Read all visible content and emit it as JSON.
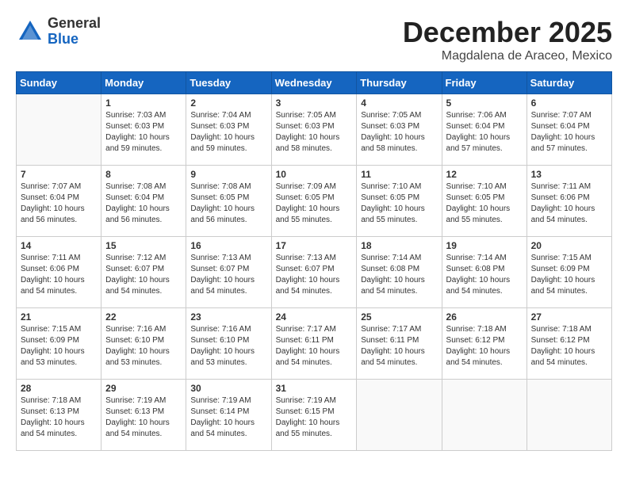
{
  "header": {
    "logo_general": "General",
    "logo_blue": "Blue",
    "month_title": "December 2025",
    "location": "Magdalena de Araceo, Mexico"
  },
  "days_of_week": [
    "Sunday",
    "Monday",
    "Tuesday",
    "Wednesday",
    "Thursday",
    "Friday",
    "Saturday"
  ],
  "weeks": [
    [
      {
        "day": "",
        "info": ""
      },
      {
        "day": "1",
        "info": "Sunrise: 7:03 AM\nSunset: 6:03 PM\nDaylight: 10 hours\nand 59 minutes."
      },
      {
        "day": "2",
        "info": "Sunrise: 7:04 AM\nSunset: 6:03 PM\nDaylight: 10 hours\nand 59 minutes."
      },
      {
        "day": "3",
        "info": "Sunrise: 7:05 AM\nSunset: 6:03 PM\nDaylight: 10 hours\nand 58 minutes."
      },
      {
        "day": "4",
        "info": "Sunrise: 7:05 AM\nSunset: 6:03 PM\nDaylight: 10 hours\nand 58 minutes."
      },
      {
        "day": "5",
        "info": "Sunrise: 7:06 AM\nSunset: 6:04 PM\nDaylight: 10 hours\nand 57 minutes."
      },
      {
        "day": "6",
        "info": "Sunrise: 7:07 AM\nSunset: 6:04 PM\nDaylight: 10 hours\nand 57 minutes."
      }
    ],
    [
      {
        "day": "7",
        "info": "Sunrise: 7:07 AM\nSunset: 6:04 PM\nDaylight: 10 hours\nand 56 minutes."
      },
      {
        "day": "8",
        "info": "Sunrise: 7:08 AM\nSunset: 6:04 PM\nDaylight: 10 hours\nand 56 minutes."
      },
      {
        "day": "9",
        "info": "Sunrise: 7:08 AM\nSunset: 6:05 PM\nDaylight: 10 hours\nand 56 minutes."
      },
      {
        "day": "10",
        "info": "Sunrise: 7:09 AM\nSunset: 6:05 PM\nDaylight: 10 hours\nand 55 minutes."
      },
      {
        "day": "11",
        "info": "Sunrise: 7:10 AM\nSunset: 6:05 PM\nDaylight: 10 hours\nand 55 minutes."
      },
      {
        "day": "12",
        "info": "Sunrise: 7:10 AM\nSunset: 6:05 PM\nDaylight: 10 hours\nand 55 minutes."
      },
      {
        "day": "13",
        "info": "Sunrise: 7:11 AM\nSunset: 6:06 PM\nDaylight: 10 hours\nand 54 minutes."
      }
    ],
    [
      {
        "day": "14",
        "info": "Sunrise: 7:11 AM\nSunset: 6:06 PM\nDaylight: 10 hours\nand 54 minutes."
      },
      {
        "day": "15",
        "info": "Sunrise: 7:12 AM\nSunset: 6:07 PM\nDaylight: 10 hours\nand 54 minutes."
      },
      {
        "day": "16",
        "info": "Sunrise: 7:13 AM\nSunset: 6:07 PM\nDaylight: 10 hours\nand 54 minutes."
      },
      {
        "day": "17",
        "info": "Sunrise: 7:13 AM\nSunset: 6:07 PM\nDaylight: 10 hours\nand 54 minutes."
      },
      {
        "day": "18",
        "info": "Sunrise: 7:14 AM\nSunset: 6:08 PM\nDaylight: 10 hours\nand 54 minutes."
      },
      {
        "day": "19",
        "info": "Sunrise: 7:14 AM\nSunset: 6:08 PM\nDaylight: 10 hours\nand 54 minutes."
      },
      {
        "day": "20",
        "info": "Sunrise: 7:15 AM\nSunset: 6:09 PM\nDaylight: 10 hours\nand 54 minutes."
      }
    ],
    [
      {
        "day": "21",
        "info": "Sunrise: 7:15 AM\nSunset: 6:09 PM\nDaylight: 10 hours\nand 53 minutes."
      },
      {
        "day": "22",
        "info": "Sunrise: 7:16 AM\nSunset: 6:10 PM\nDaylight: 10 hours\nand 53 minutes."
      },
      {
        "day": "23",
        "info": "Sunrise: 7:16 AM\nSunset: 6:10 PM\nDaylight: 10 hours\nand 53 minutes."
      },
      {
        "day": "24",
        "info": "Sunrise: 7:17 AM\nSunset: 6:11 PM\nDaylight: 10 hours\nand 54 minutes."
      },
      {
        "day": "25",
        "info": "Sunrise: 7:17 AM\nSunset: 6:11 PM\nDaylight: 10 hours\nand 54 minutes."
      },
      {
        "day": "26",
        "info": "Sunrise: 7:18 AM\nSunset: 6:12 PM\nDaylight: 10 hours\nand 54 minutes."
      },
      {
        "day": "27",
        "info": "Sunrise: 7:18 AM\nSunset: 6:12 PM\nDaylight: 10 hours\nand 54 minutes."
      }
    ],
    [
      {
        "day": "28",
        "info": "Sunrise: 7:18 AM\nSunset: 6:13 PM\nDaylight: 10 hours\nand 54 minutes."
      },
      {
        "day": "29",
        "info": "Sunrise: 7:19 AM\nSunset: 6:13 PM\nDaylight: 10 hours\nand 54 minutes."
      },
      {
        "day": "30",
        "info": "Sunrise: 7:19 AM\nSunset: 6:14 PM\nDaylight: 10 hours\nand 54 minutes."
      },
      {
        "day": "31",
        "info": "Sunrise: 7:19 AM\nSunset: 6:15 PM\nDaylight: 10 hours\nand 55 minutes."
      },
      {
        "day": "",
        "info": ""
      },
      {
        "day": "",
        "info": ""
      },
      {
        "day": "",
        "info": ""
      }
    ]
  ]
}
